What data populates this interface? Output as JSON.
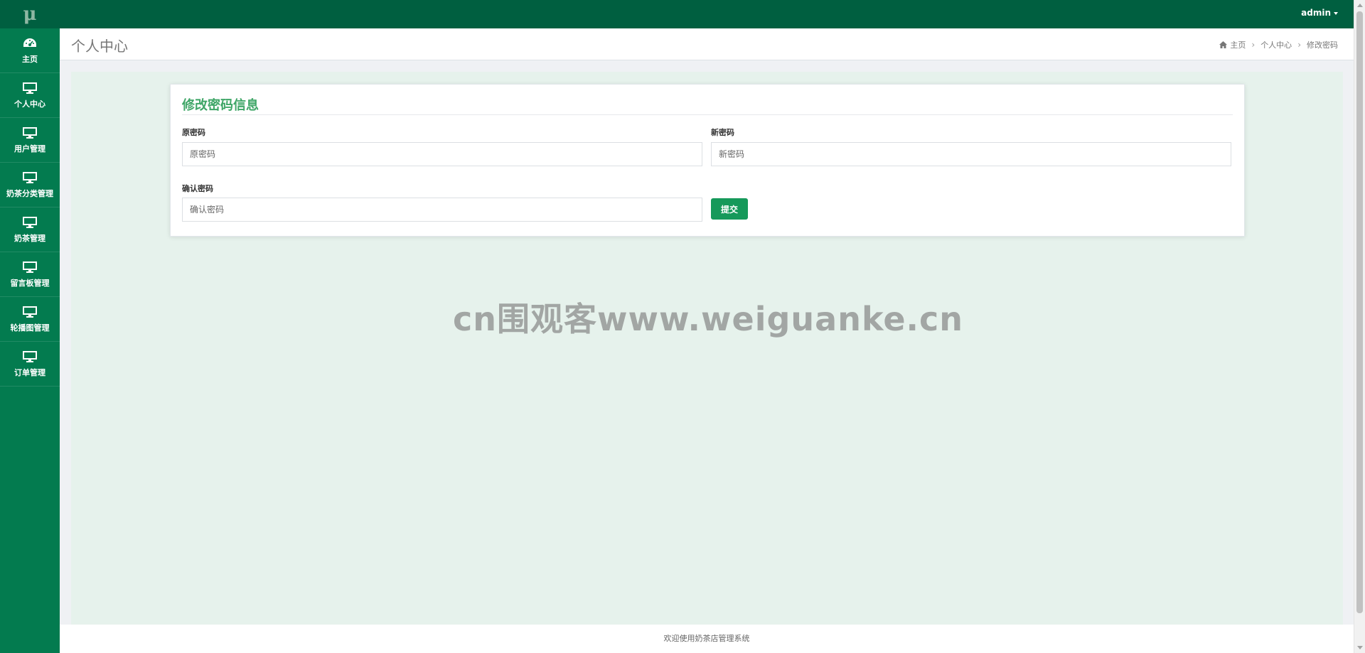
{
  "sidebar": {
    "logo": "μ",
    "items": [
      {
        "label": "主页",
        "icon": "dashboard-icon"
      },
      {
        "label": "个人中心",
        "icon": "monitor-icon"
      },
      {
        "label": "用户管理",
        "icon": "monitor-icon"
      },
      {
        "label": "奶茶分类管理",
        "icon": "monitor-icon"
      },
      {
        "label": "奶茶管理",
        "icon": "monitor-icon"
      },
      {
        "label": "留言板管理",
        "icon": "monitor-icon"
      },
      {
        "label": "轮播图管理",
        "icon": "monitor-icon"
      },
      {
        "label": "订单管理",
        "icon": "monitor-icon"
      }
    ]
  },
  "topbar": {
    "user": "admin"
  },
  "header": {
    "title": "个人中心",
    "breadcrumb": [
      "主页",
      "个人中心",
      "修改密码"
    ]
  },
  "form": {
    "title": "修改密码信息",
    "old_password": {
      "label": "原密码",
      "placeholder": "原密码"
    },
    "new_password": {
      "label": "新密码",
      "placeholder": "新密码"
    },
    "confirm_password": {
      "label": "确认密码",
      "placeholder": "确认密码"
    },
    "submit_label": "提交"
  },
  "watermark": "cn围观客www.weiguanke.cn",
  "footer": {
    "text": "欢迎使用奶茶店管理系统"
  },
  "colors": {
    "sidebar_bg": "#037b4f",
    "topbar_bg": "#005f40",
    "accent": "#3fa667",
    "button": "#16995a",
    "content_bg": "#e6f2ec"
  }
}
